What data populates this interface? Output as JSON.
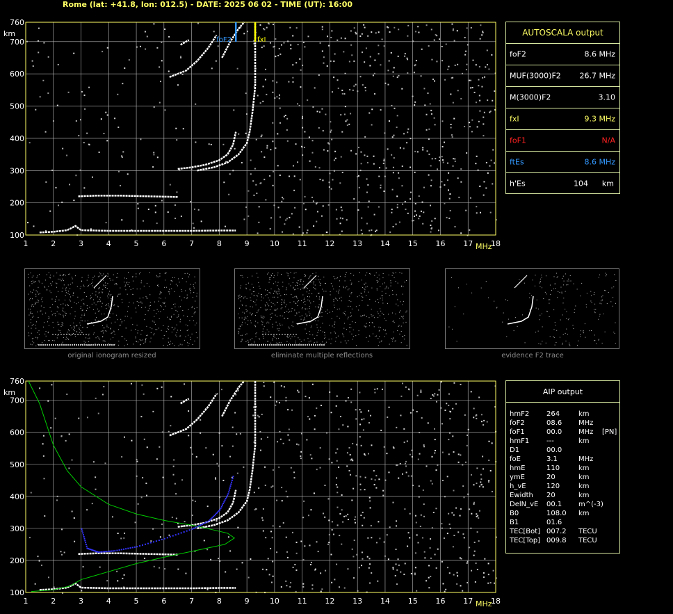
{
  "header": {
    "title": "Rome (lat: +41.8, lon: 012.5) - DATE: 2025 06 02 - TIME (UT): 16:00"
  },
  "colors": {
    "grid": "#bcbcbc",
    "frame": "#ffff66",
    "trace": "#ffffff",
    "foF2_marker": "#3399ff",
    "fxI_marker": "#ffff00",
    "aip_profile": "#00cc00",
    "aip_points": "#3333ff",
    "box_border": "#d7e8a0"
  },
  "chart_data": [
    {
      "type": "scatter",
      "name": "ionogram-top",
      "ylabel": "km",
      "xlabel": "MHz",
      "xlim": [
        1,
        18
      ],
      "ylim": [
        100,
        760
      ],
      "x_ticks": [
        "1",
        "2",
        "3",
        "4",
        "5",
        "6",
        "7",
        "8",
        "9",
        "10",
        "11",
        "12",
        "13",
        "14",
        "15",
        "16",
        "17",
        "18"
      ],
      "y_ticks": [
        "100",
        "200",
        "300",
        "400",
        "500",
        "600",
        "700",
        "760"
      ],
      "markers": [
        {
          "label": "foF2",
          "x": 8.6,
          "color": "#3399ff"
        },
        {
          "label": "fxI",
          "x": 9.3,
          "color": "#ffff00"
        }
      ],
      "traces": {
        "es_layer": [
          [
            1.5,
            108
          ],
          [
            2.0,
            110
          ],
          [
            2.5,
            115
          ],
          [
            2.8,
            128
          ],
          [
            3.0,
            115
          ],
          [
            4,
            113
          ],
          [
            5,
            113
          ],
          [
            6,
            113
          ],
          [
            7,
            113
          ],
          [
            8,
            114
          ],
          [
            8.6,
            114
          ]
        ],
        "es_second": [
          [
            2.9,
            220
          ],
          [
            3.5,
            222
          ],
          [
            4.5,
            222
          ],
          [
            5.5,
            220
          ],
          [
            6.5,
            218
          ]
        ],
        "f2_o": [
          [
            6.5,
            305
          ],
          [
            7.0,
            310
          ],
          [
            7.5,
            318
          ],
          [
            8.0,
            332
          ],
          [
            8.3,
            350
          ],
          [
            8.5,
            380
          ],
          [
            8.6,
            420
          ]
        ],
        "f2_x": [
          [
            7.2,
            300
          ],
          [
            7.8,
            310
          ],
          [
            8.3,
            325
          ],
          [
            8.7,
            350
          ],
          [
            9.0,
            385
          ],
          [
            9.1,
            420
          ],
          [
            9.2,
            480
          ],
          [
            9.3,
            560
          ],
          [
            9.3,
            760
          ]
        ],
        "f2_2hop_a": [
          [
            6.2,
            590
          ],
          [
            6.8,
            610
          ],
          [
            7.2,
            640
          ],
          [
            7.6,
            680
          ],
          [
            7.9,
            720
          ]
        ],
        "f2_2hop_b": [
          [
            8.1,
            650
          ],
          [
            8.4,
            700
          ],
          [
            8.7,
            740
          ],
          [
            8.9,
            760
          ]
        ],
        "f2_3hop": [
          [
            6.6,
            690
          ],
          [
            6.9,
            705
          ]
        ]
      }
    },
    {
      "type": "scatter",
      "name": "ionogram-bottom",
      "ylabel": "km",
      "xlabel": "MHz",
      "xlim": [
        1,
        18
      ],
      "ylim": [
        100,
        760
      ],
      "x_ticks": [
        "1",
        "2",
        "3",
        "4",
        "5",
        "6",
        "7",
        "8",
        "9",
        "10",
        "11",
        "12",
        "13",
        "14",
        "15",
        "16",
        "17",
        "18"
      ],
      "y_ticks": [
        "100",
        "200",
        "300",
        "400",
        "500",
        "600",
        "700",
        "760"
      ],
      "profile": [
        [
          1.1,
          760
        ],
        [
          1.5,
          690
        ],
        [
          2.0,
          560
        ],
        [
          2.5,
          480
        ],
        [
          3.0,
          430
        ],
        [
          4.0,
          375
        ],
        [
          5.0,
          345
        ],
        [
          6.0,
          325
        ],
        [
          7.0,
          310
        ],
        [
          7.8,
          295
        ],
        [
          8.3,
          285
        ],
        [
          8.55,
          270
        ],
        [
          8.2,
          250
        ],
        [
          7.0,
          228
        ],
        [
          6.0,
          210
        ],
        [
          5.0,
          190
        ],
        [
          4.0,
          165
        ],
        [
          3.0,
          140
        ],
        [
          2.6,
          120
        ],
        [
          2.0,
          108
        ],
        [
          1.2,
          103
        ]
      ],
      "aip_points": [
        [
          3.0,
          300
        ],
        [
          3.2,
          240
        ],
        [
          3.6,
          228
        ],
        [
          4.2,
          232
        ],
        [
          5.0,
          245
        ],
        [
          6.0,
          270
        ],
        [
          7.0,
          300
        ],
        [
          7.6,
          325
        ],
        [
          8.0,
          360
        ],
        [
          8.3,
          410
        ],
        [
          8.5,
          470
        ]
      ]
    }
  ],
  "autoscala": {
    "title": "AUTOSCALA output",
    "rows": [
      {
        "label": "foF2",
        "value": "8.6 MHz",
        "color": "#ffffff"
      },
      {
        "label": "MUF(3000)F2",
        "value": "26.7 MHz",
        "color": "#ffffff"
      },
      {
        "label": "M(3000)F2",
        "value": "3.10",
        "color": "#ffffff"
      },
      {
        "label": "fxI",
        "value": "9.3 MHz",
        "color": "#ffff66"
      },
      {
        "label": "foF1",
        "value": "N/A",
        "color": "#ff2222"
      },
      {
        "label": "ftEs",
        "value": "8.6 MHz",
        "color": "#3399ff"
      },
      {
        "label": "h'Es",
        "value": "104",
        "unit": "km",
        "color": "#ffffff"
      }
    ]
  },
  "aip": {
    "title": "AIP output",
    "rows": [
      {
        "k": "hmF2",
        "v": "264",
        "u": "km",
        "x": ""
      },
      {
        "k": "foF2",
        "v": "08.6",
        "u": "MHz",
        "x": ""
      },
      {
        "k": "foF1",
        "v": "00.0",
        "u": "MHz",
        "x": "[PN]"
      },
      {
        "k": "hmF1",
        "v": "---",
        "u": "km",
        "x": ""
      },
      {
        "k": "D1",
        "v": "00.0",
        "u": "",
        "x": ""
      },
      {
        "k": "foE",
        "v": "3.1",
        "u": "MHz",
        "x": ""
      },
      {
        "k": "hmE",
        "v": "110",
        "u": "km",
        "x": ""
      },
      {
        "k": "ymE",
        "v": "20",
        "u": "km",
        "x": ""
      },
      {
        "k": "h_vE",
        "v": "120",
        "u": "km",
        "x": ""
      },
      {
        "k": "Ewidth",
        "v": "20",
        "u": "km",
        "x": ""
      },
      {
        "k": "DelN_vE",
        "v": "00.1",
        "u": "m^(-3)",
        "x": ""
      },
      {
        "k": "B0",
        "v": "108.0",
        "u": "km",
        "x": ""
      },
      {
        "k": "B1",
        "v": "01.6",
        "u": "",
        "x": ""
      },
      {
        "k": "TEC[Bot]",
        "v": "007.2",
        "u": "TECU",
        "x": ""
      },
      {
        "k": "TEC[Top]",
        "v": "009.8",
        "u": "TECU",
        "x": ""
      }
    ]
  },
  "thumbnails": [
    {
      "caption": "original ionogram resized"
    },
    {
      "caption": "eliminate multiple reflections"
    },
    {
      "caption": "evidence F2 trace"
    }
  ]
}
